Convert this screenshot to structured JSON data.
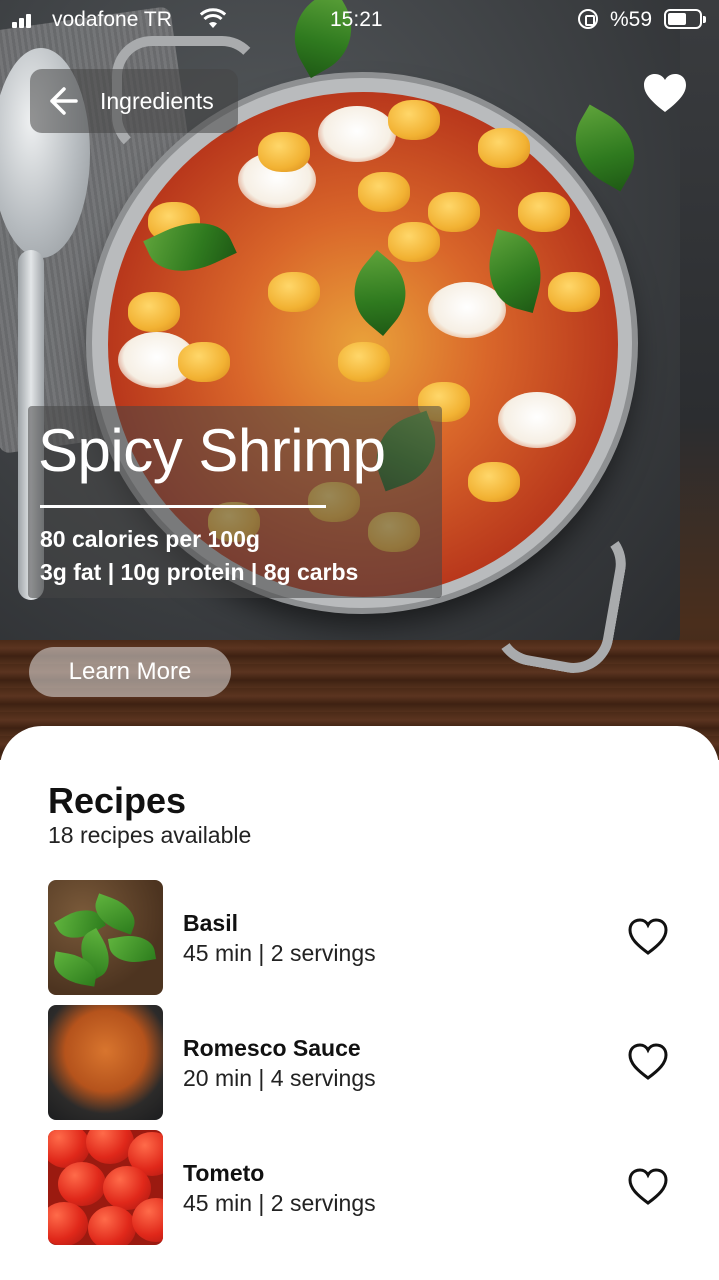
{
  "status_bar": {
    "carrier": "vodafone TR",
    "time": "15:21",
    "battery": "%59"
  },
  "header": {
    "back_label": "Ingredients",
    "favorite_icon": "heart-filled-icon"
  },
  "hero": {
    "title": "Spicy Shrimp",
    "calories": "80 calories per 100g",
    "macros": "3g fat | 10g protein | 8g carbs",
    "learn_more_label": "Learn More"
  },
  "recipes": {
    "title": "Recipes",
    "subtitle": "18 recipes available",
    "items": [
      {
        "name": "Basil",
        "meta": "45 min | 2 servings",
        "icon": "heart-outline-icon"
      },
      {
        "name": "Romesco Sauce",
        "meta": "20 min | 4 servings",
        "icon": "heart-outline-icon"
      },
      {
        "name": "Tometo",
        "meta": "45 min | 2 servings",
        "icon": "heart-outline-icon"
      }
    ]
  },
  "colors": {
    "text_primary": "#111111",
    "overlay": "#464646",
    "sheet_bg": "#ffffff"
  }
}
